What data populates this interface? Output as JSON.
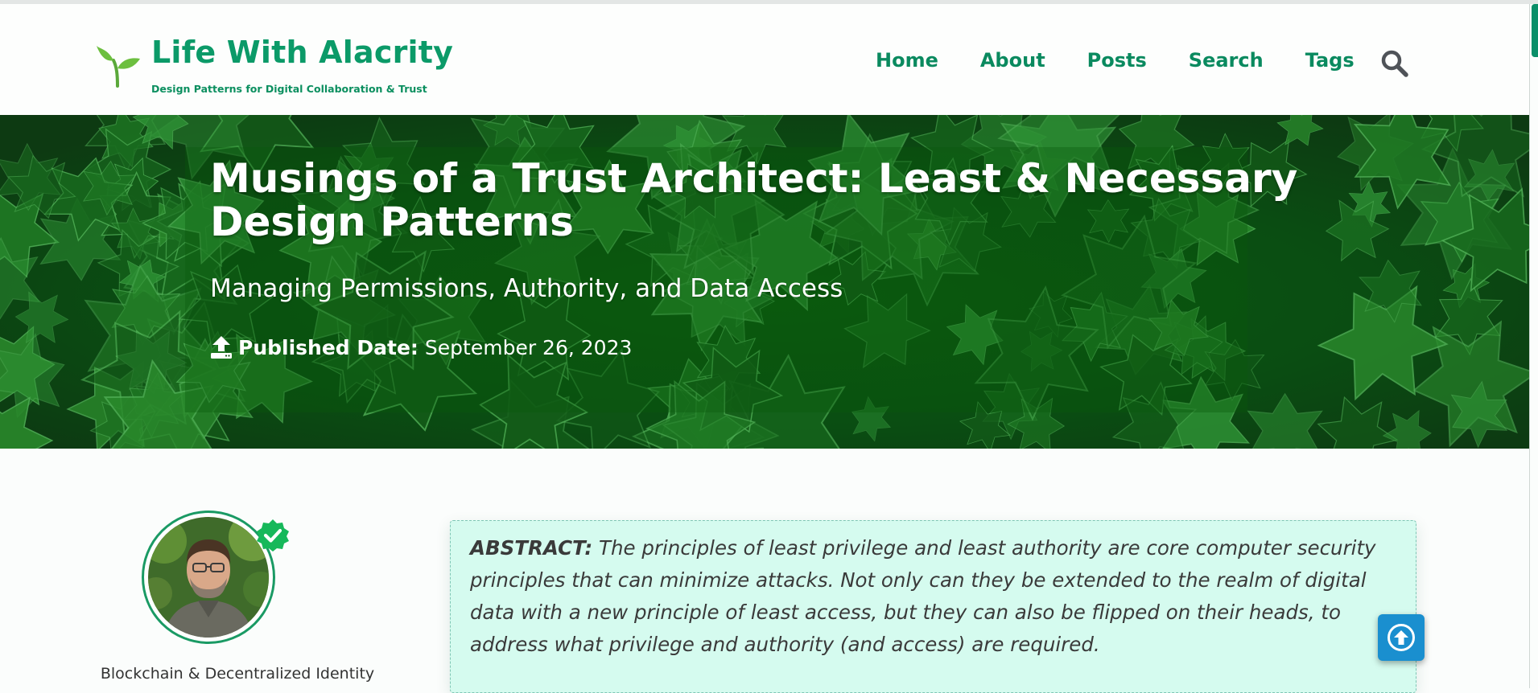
{
  "site": {
    "title": "Life With Alacrity",
    "tagline": "Design Patterns for Digital Collaboration & Trust"
  },
  "nav": {
    "items": [
      "Home",
      "About",
      "Posts",
      "Search",
      "Tags"
    ],
    "search_icon": "magnifier-icon"
  },
  "hero": {
    "title": "Musings of a Trust Architect: Least & Necessary Design Patterns",
    "subtitle": "Managing Permissions, Authority, and Data Access",
    "published_label": "Published Date:",
    "published_date": "September 26, 2023",
    "published_icon": "upload-icon"
  },
  "author": {
    "topic": "Blockchain & Decentralized Identity",
    "badge_icon": "verified-check-icon"
  },
  "abstract": {
    "label": "ABSTRACT:",
    "text": "The principles of least privilege and least authority are core computer security principles that can minimize attacks. Not only can they be extended to the realm of digital data with a new principle of least access, but they can also be flipped on their heads, to address what privilege and authority (and access) are required."
  },
  "controls": {
    "back_to_top_icon": "arrow-up-circle-icon"
  },
  "colors": {
    "brand_green": "#0b9a68",
    "hero_green": "#0a4f12",
    "abstract_bg": "#d5fbef",
    "back_to_top_blue": "#1a8fcf"
  }
}
